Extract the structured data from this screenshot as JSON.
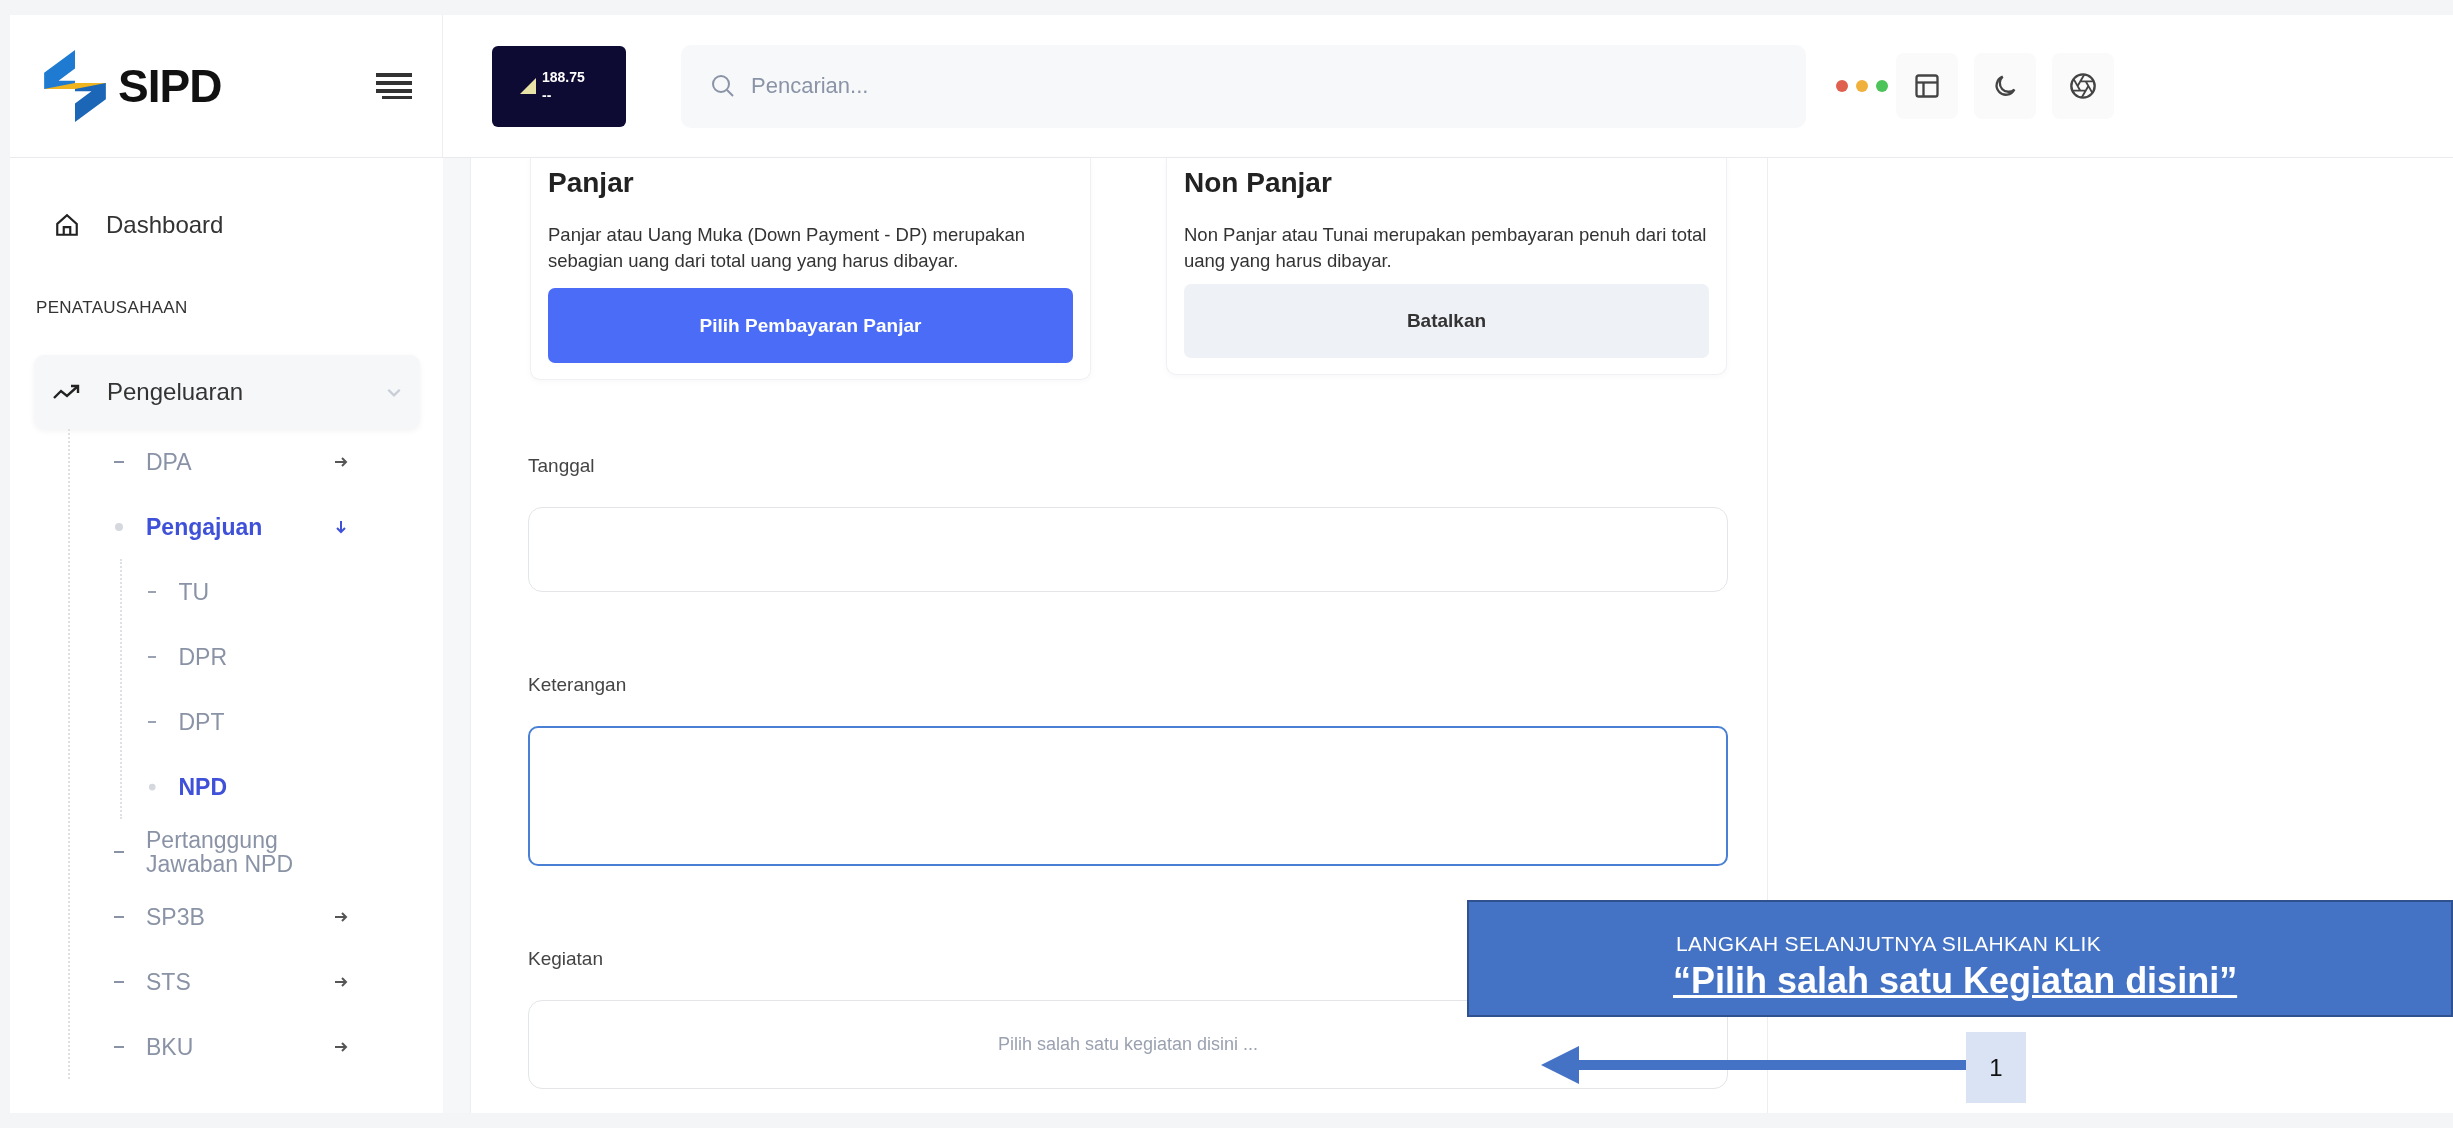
{
  "header": {
    "logo_text": "SIPD",
    "network": {
      "reading": "188.75",
      "unit": "--"
    },
    "search": {
      "placeholder": "Pencarian..."
    },
    "status_dots": [
      {
        "color": "#e0604f"
      },
      {
        "color": "#f0b03c"
      },
      {
        "color": "#4cc45a"
      }
    ]
  },
  "sidebar": {
    "items": [
      {
        "kind": "link",
        "label": "Dashboard"
      },
      {
        "kind": "section",
        "label": "PENATAUSAHAAN"
      },
      {
        "kind": "group",
        "label": "Pengeluaran",
        "expanded": true,
        "children": [
          {
            "label": "DPA",
            "selected": false,
            "expanded": false
          },
          {
            "label": "Pengajuan",
            "selected": true,
            "expanded": true,
            "children": [
              {
                "label": "TU",
                "selected": false
              },
              {
                "label": "DPR",
                "selected": false
              },
              {
                "label": "DPT",
                "selected": false
              },
              {
                "label": "NPD",
                "selected": true
              }
            ]
          },
          {
            "label": "Pertanggung Jawaban NPD",
            "selected": false
          },
          {
            "label": "SP3B",
            "selected": false,
            "expanded": false
          },
          {
            "label": "STS",
            "selected": false,
            "expanded": false
          },
          {
            "label": "BKU",
            "selected": false,
            "expanded": false
          }
        ]
      }
    ]
  },
  "payment_options": [
    {
      "title": "Panjar",
      "description": "Panjar atau Uang Muka (Down Payment - DP) merupakan sebagian uang dari total uang yang harus dibayar.",
      "button": "Pilih Pembayaran Panjar",
      "kind": "primary"
    },
    {
      "title": "Non Panjar",
      "description": "Non Panjar atau Tunai merupakan pembayaran penuh dari total uang yang harus dibayar.",
      "button": "Batalkan",
      "kind": "secondary"
    }
  ],
  "form_fields": [
    {
      "label": "Tanggal",
      "kind": "date",
      "focused": false
    },
    {
      "label": "Keterangan",
      "kind": "textarea",
      "focused": true
    },
    {
      "label": "Kegiatan",
      "kind": "select",
      "focused": false,
      "placeholder": "Pilih salah satu kegiatan disini ..."
    }
  ],
  "callout": {
    "line1": "LANGKAH SELANJUTNYA SILAHKAN KLIK",
    "line2": "“Pilih salah satu Kegiatan disini”",
    "step": "1"
  }
}
